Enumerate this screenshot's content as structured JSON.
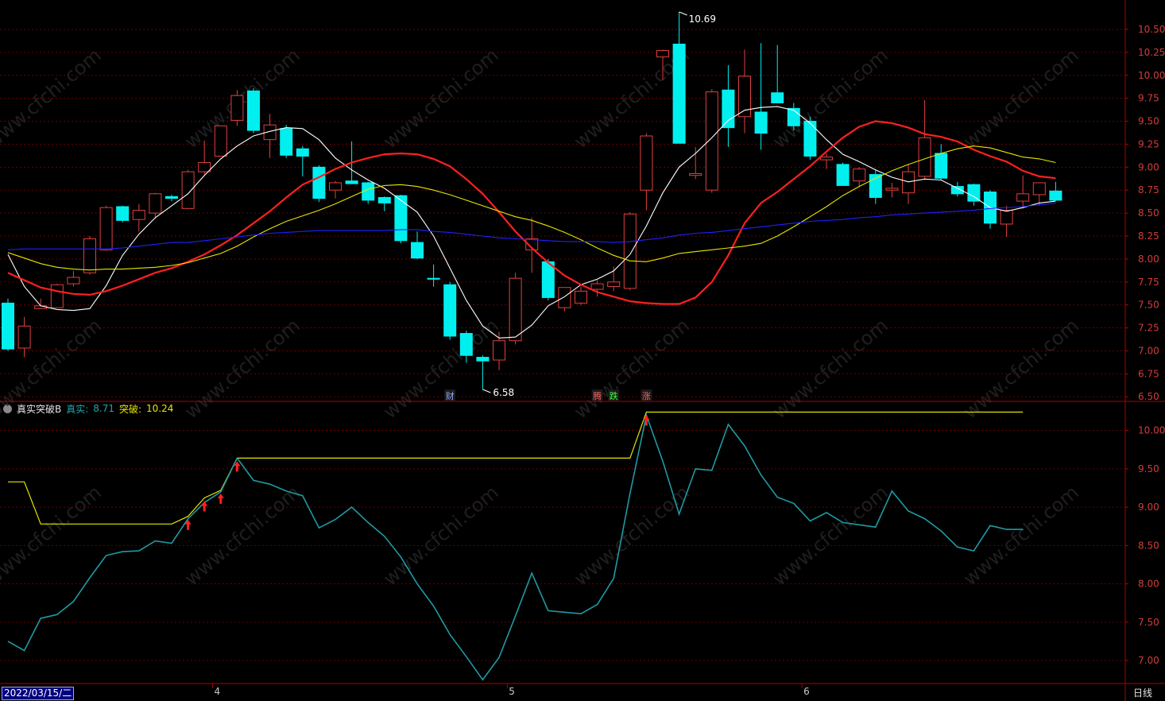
{
  "colors": {
    "frame": "#b00000",
    "grid": "#6e0000",
    "axis_text": "#d23c3c",
    "up_candle": "#e04040",
    "down_candle": "#00f0f0",
    "ma_white": "#ffffff",
    "ma_red": "#ff2020",
    "ma_yellow": "#e6e600",
    "ma_blue": "#2020ff",
    "real_line": "#1f9aa3",
    "break_line": "#e6e600",
    "arrow": "#ff2020",
    "watermark": "#ffffff"
  },
  "watermark_text": "www.cfchi.com",
  "main_panel": {
    "high_label": "10.69",
    "low_label": "6.58",
    "event_marks": [
      {
        "index": 27,
        "text": "财",
        "color": "#9aa6ff"
      },
      {
        "index": 36,
        "text": "腾",
        "color": "#ff6060"
      },
      {
        "index": 37,
        "text": "跌",
        "color": "#40ff40"
      },
      {
        "index": 39,
        "text": "涨",
        "color": "#ff6060"
      }
    ]
  },
  "indicator": {
    "toggle_icon": "chevron-down-icon",
    "name": "真实突破B",
    "real_label": "真实:",
    "real_value": "8.71",
    "break_label": "突破:",
    "break_value": "10.24"
  },
  "bottom": {
    "date": "2022/03/15/二",
    "period": "日线",
    "months": [
      {
        "index": 13,
        "text": "4"
      },
      {
        "index": 31,
        "text": "5"
      },
      {
        "index": 49,
        "text": "6"
      }
    ]
  },
  "chart_data": [
    {
      "type": "candlestick",
      "title": "",
      "ylim": [
        6.45,
        10.82
      ],
      "yticks": [
        6.5,
        6.75,
        7.0,
        7.25,
        7.5,
        7.75,
        8.0,
        8.25,
        8.5,
        8.75,
        9.0,
        9.25,
        9.5,
        9.75,
        10.0,
        10.25,
        10.5
      ],
      "ohlc": [
        [
          7.52,
          7.57,
          7.0,
          7.02
        ],
        [
          7.03,
          7.37,
          6.93,
          7.27
        ],
        [
          7.46,
          7.57,
          7.46,
          7.49
        ],
        [
          7.47,
          7.73,
          7.47,
          7.72
        ],
        [
          7.73,
          7.87,
          7.7,
          7.8
        ],
        [
          7.85,
          8.25,
          7.83,
          8.22
        ],
        [
          8.1,
          8.58,
          8.09,
          8.56
        ],
        [
          8.57,
          8.58,
          8.4,
          8.42
        ],
        [
          8.43,
          8.6,
          8.3,
          8.53
        ],
        [
          8.5,
          8.72,
          8.44,
          8.71
        ],
        [
          8.68,
          8.7,
          8.63,
          8.66
        ],
        [
          8.55,
          8.97,
          8.55,
          8.95
        ],
        [
          8.95,
          9.29,
          8.92,
          9.05
        ],
        [
          9.12,
          9.45,
          9.12,
          9.45
        ],
        [
          9.51,
          9.84,
          9.45,
          9.78
        ],
        [
          9.83,
          9.86,
          9.37,
          9.4
        ],
        [
          9.3,
          9.58,
          9.1,
          9.46
        ],
        [
          9.42,
          9.46,
          9.1,
          9.13
        ],
        [
          9.2,
          9.23,
          8.9,
          9.12
        ],
        [
          9.0,
          9.02,
          8.62,
          8.66
        ],
        [
          8.75,
          8.85,
          8.66,
          8.83
        ],
        [
          8.85,
          9.28,
          8.84,
          8.82
        ],
        [
          8.83,
          8.84,
          8.6,
          8.64
        ],
        [
          8.67,
          8.68,
          8.52,
          8.61
        ],
        [
          8.69,
          8.7,
          8.17,
          8.2
        ],
        [
          8.18,
          8.3,
          8.0,
          8.01
        ],
        [
          7.79,
          7.94,
          7.7,
          7.78
        ],
        [
          7.72,
          7.75,
          7.12,
          7.16
        ],
        [
          7.19,
          7.22,
          6.87,
          6.95
        ],
        [
          6.93,
          6.95,
          6.58,
          6.89
        ],
        [
          6.9,
          7.21,
          6.79,
          7.11
        ],
        [
          7.11,
          7.85,
          7.07,
          7.79
        ],
        [
          8.1,
          8.45,
          7.85,
          8.22
        ],
        [
          7.97,
          8.0,
          7.55,
          7.58
        ],
        [
          7.47,
          7.68,
          7.43,
          7.69
        ],
        [
          7.52,
          7.7,
          7.5,
          7.65
        ],
        [
          7.67,
          7.77,
          7.59,
          7.73
        ],
        [
          7.7,
          7.92,
          7.65,
          7.75
        ],
        [
          7.68,
          8.51,
          7.66,
          8.49
        ],
        [
          8.75,
          9.37,
          8.53,
          9.34
        ],
        [
          10.2,
          10.28,
          9.95,
          10.27
        ],
        [
          10.34,
          10.69,
          9.63,
          9.26
        ],
        [
          8.91,
          9.22,
          8.87,
          8.93
        ],
        [
          8.75,
          9.85,
          8.72,
          9.82
        ],
        [
          9.84,
          10.11,
          9.22,
          9.43
        ],
        [
          9.55,
          10.28,
          9.37,
          9.99
        ],
        [
          9.6,
          10.35,
          9.19,
          9.37
        ],
        [
          9.81,
          10.33,
          9.7,
          9.7
        ],
        [
          9.64,
          9.7,
          9.4,
          9.45
        ],
        [
          9.5,
          9.55,
          9.08,
          9.12
        ],
        [
          9.08,
          9.15,
          8.98,
          9.11
        ],
        [
          9.03,
          9.05,
          8.8,
          8.8
        ],
        [
          8.85,
          9.0,
          8.78,
          8.98
        ],
        [
          8.92,
          8.97,
          8.6,
          8.67
        ],
        [
          8.75,
          8.83,
          8.67,
          8.77
        ],
        [
          8.72,
          9.03,
          8.6,
          8.95
        ],
        [
          8.9,
          9.73,
          8.87,
          9.32
        ],
        [
          9.15,
          9.25,
          8.86,
          8.88
        ],
        [
          8.79,
          8.84,
          8.68,
          8.71
        ],
        [
          8.81,
          8.82,
          8.58,
          8.63
        ],
        [
          8.73,
          8.75,
          8.33,
          8.39
        ],
        [
          8.38,
          8.58,
          8.24,
          8.53
        ],
        [
          8.63,
          8.91,
          8.55,
          8.71
        ],
        [
          8.7,
          8.8,
          8.58,
          8.83
        ],
        [
          8.74,
          8.84,
          8.65,
          8.64
        ]
      ],
      "series": [
        {
          "name": "",
          "color": "#ffffff",
          "values": [
            8.05,
            7.7,
            7.49,
            7.45,
            7.44,
            7.46,
            7.71,
            8.04,
            8.27,
            8.45,
            8.58,
            8.71,
            8.91,
            9.09,
            9.23,
            9.34,
            9.39,
            9.43,
            9.42,
            9.3,
            9.1,
            8.97,
            8.86,
            8.77,
            8.64,
            8.51,
            8.25,
            7.9,
            7.55,
            7.27,
            7.14,
            7.15,
            7.28,
            7.49,
            7.59,
            7.72,
            7.78,
            7.87,
            8.05,
            8.36,
            8.72,
            9.0,
            9.15,
            9.32,
            9.51,
            9.62,
            9.65,
            9.66,
            9.62,
            9.48,
            9.3,
            9.14,
            9.06,
            8.97,
            8.89,
            8.84,
            8.87,
            8.86,
            8.77,
            8.68,
            8.56,
            8.52,
            8.56,
            8.61,
            8.63
          ]
        },
        {
          "name": "",
          "color": "#ff2020",
          "values": [
            7.85,
            7.77,
            7.69,
            7.65,
            7.62,
            7.61,
            7.65,
            7.71,
            7.78,
            7.85,
            7.9,
            7.97,
            8.05,
            8.15,
            8.26,
            8.39,
            8.52,
            8.67,
            8.81,
            8.89,
            8.98,
            9.05,
            9.1,
            9.14,
            9.15,
            9.14,
            9.09,
            9.01,
            8.87,
            8.71,
            8.51,
            8.3,
            8.12,
            7.96,
            7.82,
            7.72,
            7.64,
            7.59,
            7.54,
            7.52,
            7.51,
            7.51,
            7.58,
            7.75,
            8.04,
            8.39,
            8.61,
            8.73,
            8.87,
            9.01,
            9.17,
            9.32,
            9.44,
            9.5,
            9.48,
            9.43,
            9.36,
            9.33,
            9.28,
            9.19,
            9.12,
            9.06,
            8.96,
            8.9,
            8.88
          ]
        },
        {
          "name": "",
          "color": "#e6e600",
          "values": [
            8.07,
            8.01,
            7.95,
            7.91,
            7.89,
            7.88,
            7.89,
            7.89,
            7.9,
            7.91,
            7.93,
            7.96,
            8.01,
            8.06,
            8.14,
            8.24,
            8.33,
            8.41,
            8.47,
            8.53,
            8.6,
            8.68,
            8.76,
            8.8,
            8.81,
            8.79,
            8.75,
            8.7,
            8.64,
            8.58,
            8.52,
            8.46,
            8.42,
            8.36,
            8.29,
            8.21,
            8.12,
            8.04,
            7.98,
            7.97,
            8.01,
            8.06,
            8.08,
            8.1,
            8.12,
            8.14,
            8.17,
            8.25,
            8.35,
            8.46,
            8.57,
            8.69,
            8.79,
            8.88,
            8.96,
            9.03,
            9.09,
            9.15,
            9.2,
            9.23,
            9.21,
            9.16,
            9.11,
            9.09,
            9.05
          ]
        },
        {
          "name": "",
          "color": "#2020ff",
          "values": [
            8.1,
            8.11,
            8.11,
            8.11,
            8.11,
            8.11,
            8.11,
            8.12,
            8.14,
            8.16,
            8.18,
            8.18,
            8.2,
            8.22,
            8.24,
            8.26,
            8.28,
            8.29,
            8.3,
            8.31,
            8.31,
            8.31,
            8.31,
            8.31,
            8.32,
            8.32,
            8.3,
            8.29,
            8.27,
            8.25,
            8.23,
            8.22,
            8.21,
            8.2,
            8.19,
            8.19,
            8.19,
            8.18,
            8.19,
            8.21,
            8.23,
            8.26,
            8.28,
            8.29,
            8.31,
            8.33,
            8.35,
            8.37,
            8.39,
            8.41,
            8.42,
            8.43,
            8.45,
            8.46,
            8.48,
            8.49,
            8.5,
            8.51,
            8.52,
            8.53,
            8.55,
            8.56,
            8.57,
            8.59,
            8.61
          ]
        }
      ]
    },
    {
      "type": "line",
      "title": "真实突破B",
      "ylim": [
        6.7,
        10.38
      ],
      "yticks": [
        7.0,
        7.5,
        8.0,
        8.5,
        9.0,
        9.5,
        10.0
      ],
      "series": [
        {
          "name": "真实",
          "color": "#1f9aa3",
          "values": [
            7.25,
            7.13,
            7.55,
            7.6,
            7.77,
            8.08,
            8.37,
            8.42,
            8.43,
            8.56,
            8.53,
            8.85,
            9.06,
            9.2,
            9.64,
            9.35,
            9.3,
            9.21,
            9.15,
            8.73,
            8.84,
            9.0,
            8.8,
            8.62,
            8.35,
            8.0,
            7.71,
            7.34,
            7.05,
            6.75,
            7.04,
            7.58,
            8.14,
            7.65,
            7.63,
            7.61,
            7.73,
            8.07,
            9.18,
            10.2,
            9.6,
            8.91,
            9.5,
            9.48,
            10.08,
            9.8,
            9.42,
            9.13,
            9.05,
            8.82,
            8.93,
            8.8,
            8.77,
            8.74,
            9.21,
            8.95,
            8.85,
            8.69,
            8.48,
            8.43,
            8.76,
            8.71,
            8.71
          ]
        },
        {
          "name": "突破",
          "color": "#e6e600",
          "values": [
            9.33,
            9.33,
            8.78,
            8.78,
            8.78,
            8.78,
            8.78,
            8.78,
            8.78,
            8.78,
            8.78,
            8.88,
            9.12,
            9.22,
            9.64,
            9.64,
            9.64,
            9.64,
            9.64,
            9.64,
            9.64,
            9.64,
            9.64,
            9.64,
            9.64,
            9.64,
            9.64,
            9.64,
            9.64,
            9.64,
            9.64,
            9.64,
            9.64,
            9.64,
            9.64,
            9.64,
            9.64,
            9.64,
            9.64,
            10.24,
            10.24,
            10.24,
            10.24,
            10.24,
            10.24,
            10.24,
            10.24,
            10.24,
            10.24,
            10.24,
            10.24,
            10.24,
            10.24,
            10.24,
            10.24,
            10.24,
            10.24,
            10.24,
            10.24,
            10.24,
            10.24,
            10.24,
            10.24
          ]
        }
      ],
      "signals": [
        11,
        12,
        13,
        14,
        39
      ]
    }
  ]
}
